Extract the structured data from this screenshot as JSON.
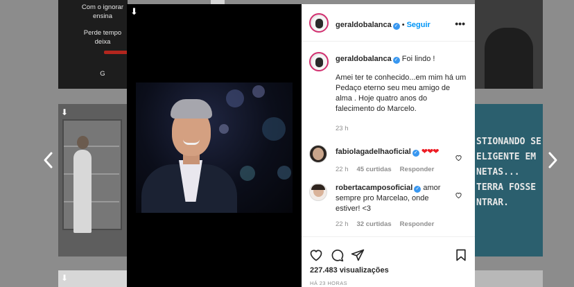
{
  "background": {
    "tile_a_lines": [
      "Com o ignorar",
      "ensina",
      "Perde tempo",
      "deixa",
      "G"
    ],
    "tile_f_lines": [
      "STIONANDO SE",
      "ELIGENTE EM",
      "NETAS...",
      "TERRA FOSSE",
      "NTRAR."
    ]
  },
  "post": {
    "username": "geraldobalanca",
    "follow_label": "Seguir",
    "separator": "•",
    "more_label": "•••",
    "caption_head": "Foi lindo !",
    "caption_text": "Amei ter te conhecido...em mim há um\nPedaço eterno seu meu amigo de alma . Hoje quatro anos do falecimento do Marcelo.",
    "caption_time": "23 h"
  },
  "comments": [
    {
      "username": "fabiolagadelhaoficial",
      "text": "❤❤❤",
      "time": "22 h",
      "likes": "45 curtidas",
      "reply_label": "Responder"
    },
    {
      "username": "robertacamposoficial",
      "text": "amor sempre pro Marcelao, onde estiver! <3",
      "time": "22 h",
      "likes": "32 curtidas",
      "reply_label": "Responder"
    }
  ],
  "stats": {
    "views": "227.483 visualizações",
    "posted": "HÁ 23 HORAS"
  },
  "colors": {
    "accent": "#0095f6",
    "verified": "#3897f0",
    "heart_red": "#ed1c24",
    "story_ring": "#d22f6f"
  }
}
